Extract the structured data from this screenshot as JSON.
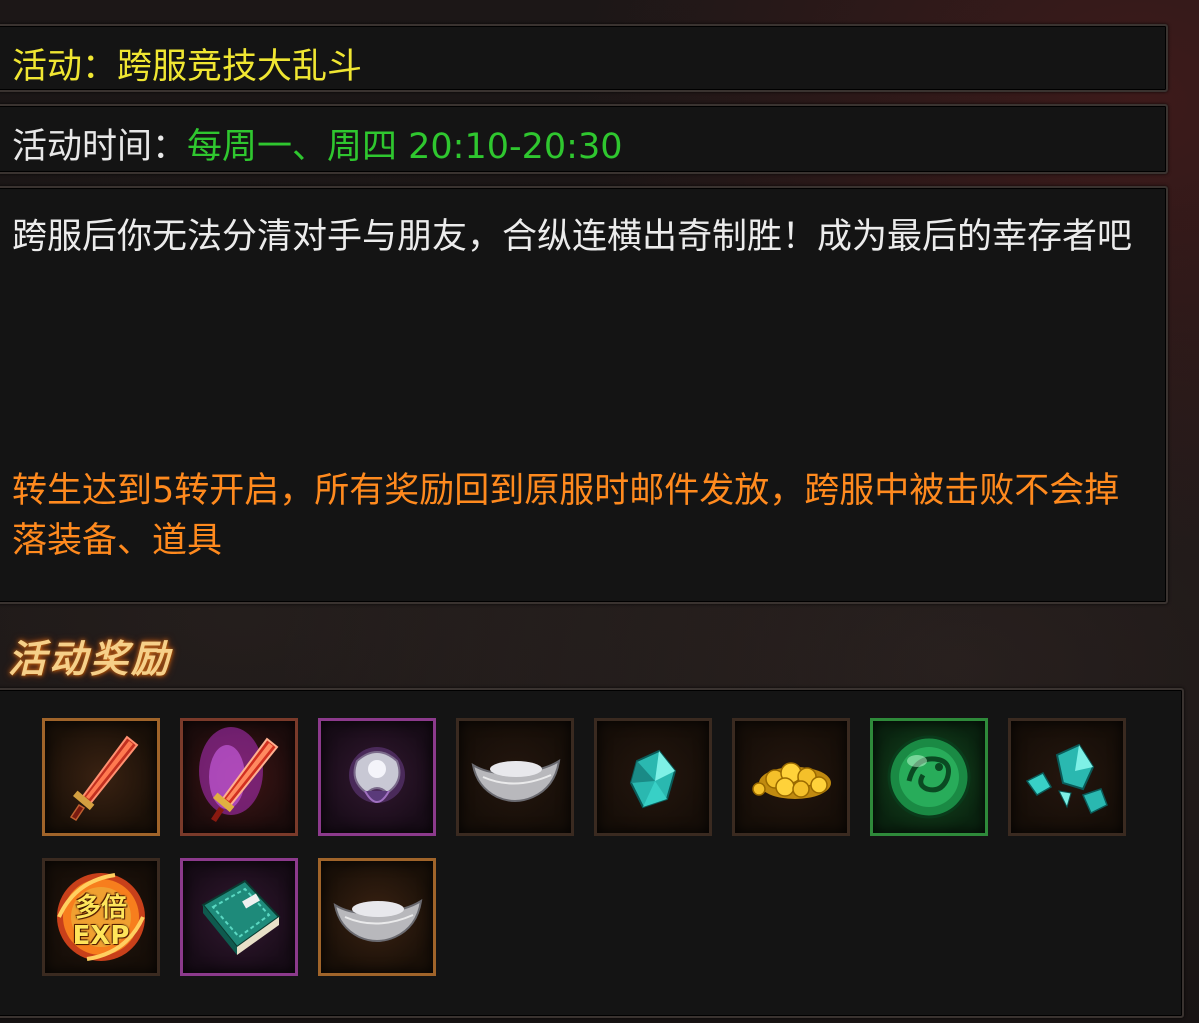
{
  "activity": {
    "title_label": "活动：",
    "title_value": "跨服竞技大乱斗",
    "time_label": "活动时间：",
    "time_value": "每周一、周四 20:10-20:30",
    "description": "跨服后你无法分清对手与朋友，合纵连横出奇制胜！成为最后的幸存者吧",
    "conditions": "转生达到5转开启，所有奖励回到原服时邮件发放，跨服中被击败不会掉落装备、道具"
  },
  "rewards": {
    "heading": "活动奖励",
    "items": [
      {
        "icon": "red-sword-icon",
        "frame": "orange"
      },
      {
        "icon": "glowing-sword-icon",
        "frame": "red"
      },
      {
        "icon": "silver-orb-icon",
        "frame": "purple"
      },
      {
        "icon": "silver-ingot-icon",
        "frame": "plain"
      },
      {
        "icon": "cyan-crystal-icon",
        "frame": "plain"
      },
      {
        "icon": "gold-coins-icon",
        "frame": "plain"
      },
      {
        "icon": "jade-dragon-orb-icon",
        "frame": "green"
      },
      {
        "icon": "crystal-shards-icon",
        "frame": "plain"
      },
      {
        "icon": "multi-exp-icon",
        "frame": "plain",
        "text_top": "多倍",
        "text_bottom": "EXP"
      },
      {
        "icon": "skill-book-icon",
        "frame": "purple"
      },
      {
        "icon": "silver-ingot-icon",
        "frame": "orange"
      }
    ]
  },
  "colors": {
    "title": "#f0e632",
    "time_value": "#2fc72f",
    "body_text": "#ececec",
    "condition_text": "#ff8a1e",
    "heading": "#f6d089"
  }
}
